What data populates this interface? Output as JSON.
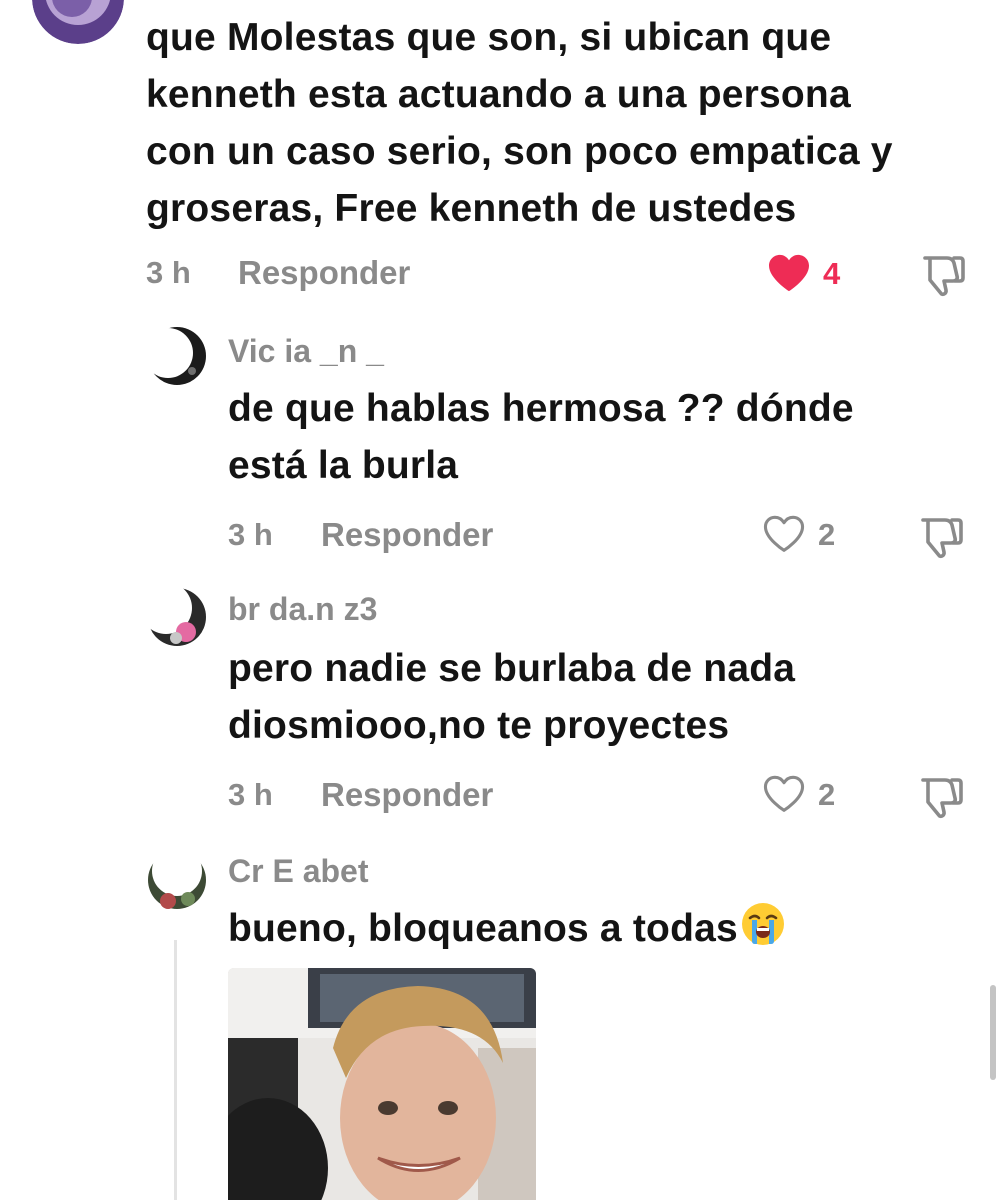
{
  "comments": [
    {
      "text": "que Molestas que son, si ubican que\nkenneth esta actuando a una persona\ncon un caso serio, son poco empatica y\ngroseras, Free kenneth de ustedes",
      "time": "3 h",
      "reply_label": "Responder",
      "likes": "4",
      "liked": true
    },
    {
      "username": "Vic  ia _n  _",
      "text": "de que hablas hermosa ?? dónde\nestá la burla",
      "time": "3 h",
      "reply_label": "Responder",
      "likes": "2",
      "liked": false
    },
    {
      "username": "br   da.n  z3",
      "text": "pero nadie se burlaba de nada\ndiosmiooo,no te proyectes",
      "time": "3 h",
      "reply_label": "Responder",
      "likes": "2",
      "liked": false
    },
    {
      "username": "Cr    E  abet",
      "text": "bueno, bloqueanos a todas",
      "emoji": "loudly-crying-face"
    }
  ],
  "icons": {
    "heart_filled": "heart-icon",
    "heart_outline": "heart-outline-icon",
    "dislike": "thumbs-down-icon"
  },
  "colors": {
    "liked": "#ee2c55",
    "meta": "#8a8a8a",
    "text": "#141414"
  }
}
